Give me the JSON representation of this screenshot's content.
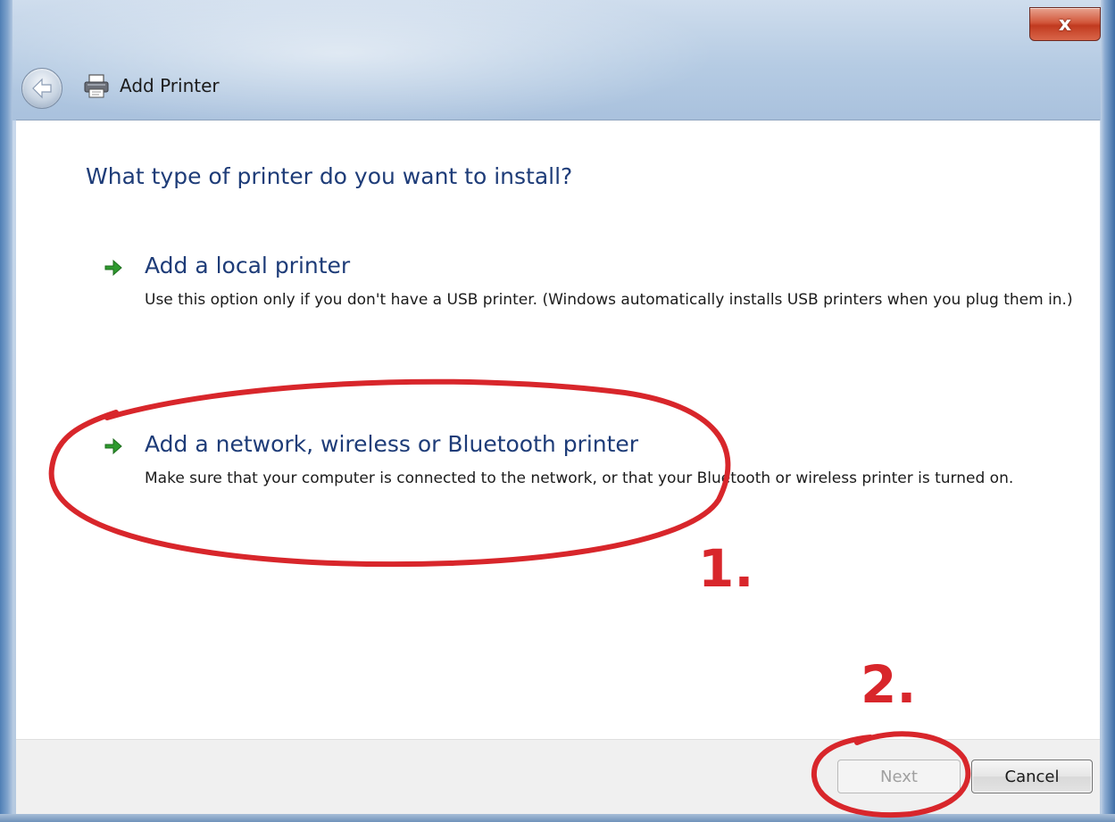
{
  "window": {
    "title": "Add Printer",
    "close_glyph": "x",
    "icons": {
      "back": "back-arrow-icon",
      "app": "printer-icon",
      "option": "green-arrow-icon"
    }
  },
  "content": {
    "heading": "What type of printer do you want to install?",
    "options": [
      {
        "title": "Add a local printer",
        "description": "Use this option only if you don't have a USB printer. (Windows automatically installs USB printers when you plug them in.)"
      },
      {
        "title": "Add a network, wireless or Bluetooth printer",
        "description": "Make sure that your computer is connected to the network, or that your Bluetooth or wireless printer is turned on."
      }
    ]
  },
  "footer": {
    "next_label": "Next",
    "next_enabled": false,
    "cancel_label": "Cancel"
  },
  "annotations": {
    "step1_label": "1.",
    "step2_label": "2.",
    "color": "#d8262b"
  },
  "colors": {
    "heading_blue": "#1e3c78",
    "arrow_green": "#2e9a2e"
  }
}
